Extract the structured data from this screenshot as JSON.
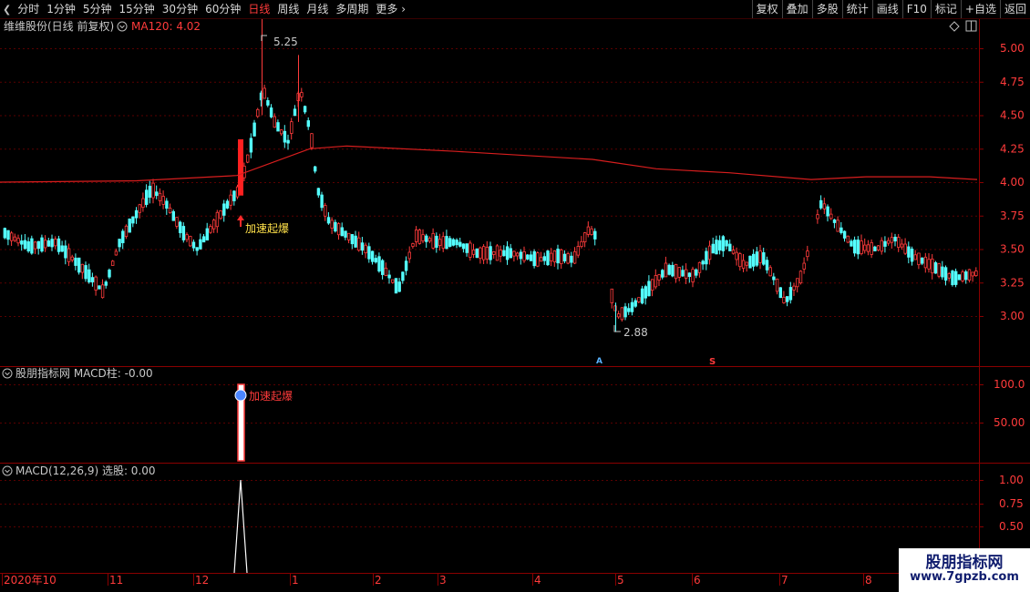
{
  "toolbar": {
    "periods": [
      "分时",
      "1分钟",
      "5分钟",
      "15分钟",
      "30分钟",
      "60分钟",
      "日线",
      "周线",
      "月线",
      "多周期",
      "更多"
    ],
    "active_period": "日线",
    "buttons": [
      "复权",
      "叠加",
      "多股",
      "统计",
      "画线",
      "F10",
      "标记",
      "+自选",
      "返回"
    ]
  },
  "main_panel": {
    "title": "维维股份(日线 前复权)",
    "indicator_label": "MA120: 4.02",
    "high_label": "5.25",
    "low_label": "2.88",
    "signal_label": "加速起爆",
    "marker_a": "A",
    "marker_s": "S",
    "y_ticks": [
      "5.00",
      "4.75",
      "4.50",
      "4.25",
      "4.00",
      "3.75",
      "3.50",
      "3.25",
      "3.00"
    ]
  },
  "panel2": {
    "title": "股朋指标网 MACD柱: -0.00",
    "signal_label": "加速起爆",
    "y_ticks": [
      "100.0",
      "50.00"
    ]
  },
  "panel3": {
    "title": "MACD(12,26,9) 选股: 0.00",
    "y_ticks": [
      "1.00",
      "0.75",
      "0.50"
    ]
  },
  "x_axis": {
    "labels": [
      "2020年10",
      "11",
      "12",
      "1",
      "2",
      "3",
      "4",
      "5",
      "6",
      "7",
      "8"
    ]
  },
  "watermark": {
    "line1": "股朋指标网",
    "line2": "www.7gpzb.com"
  },
  "colors": {
    "up": "#ff3b3b",
    "down": "#54ffff",
    "ma": "#d81e1e",
    "grid": "#6a0000",
    "signal_text": "#ffe14a",
    "marker_a": "#5ab4ff",
    "marker_s": "#ff3b3b"
  },
  "chart_data": {
    "type": "candlestick",
    "ma120_current": 4.02,
    "price_high": 5.25,
    "price_low": 2.88,
    "y_range": [
      2.8,
      5.3
    ]
  }
}
